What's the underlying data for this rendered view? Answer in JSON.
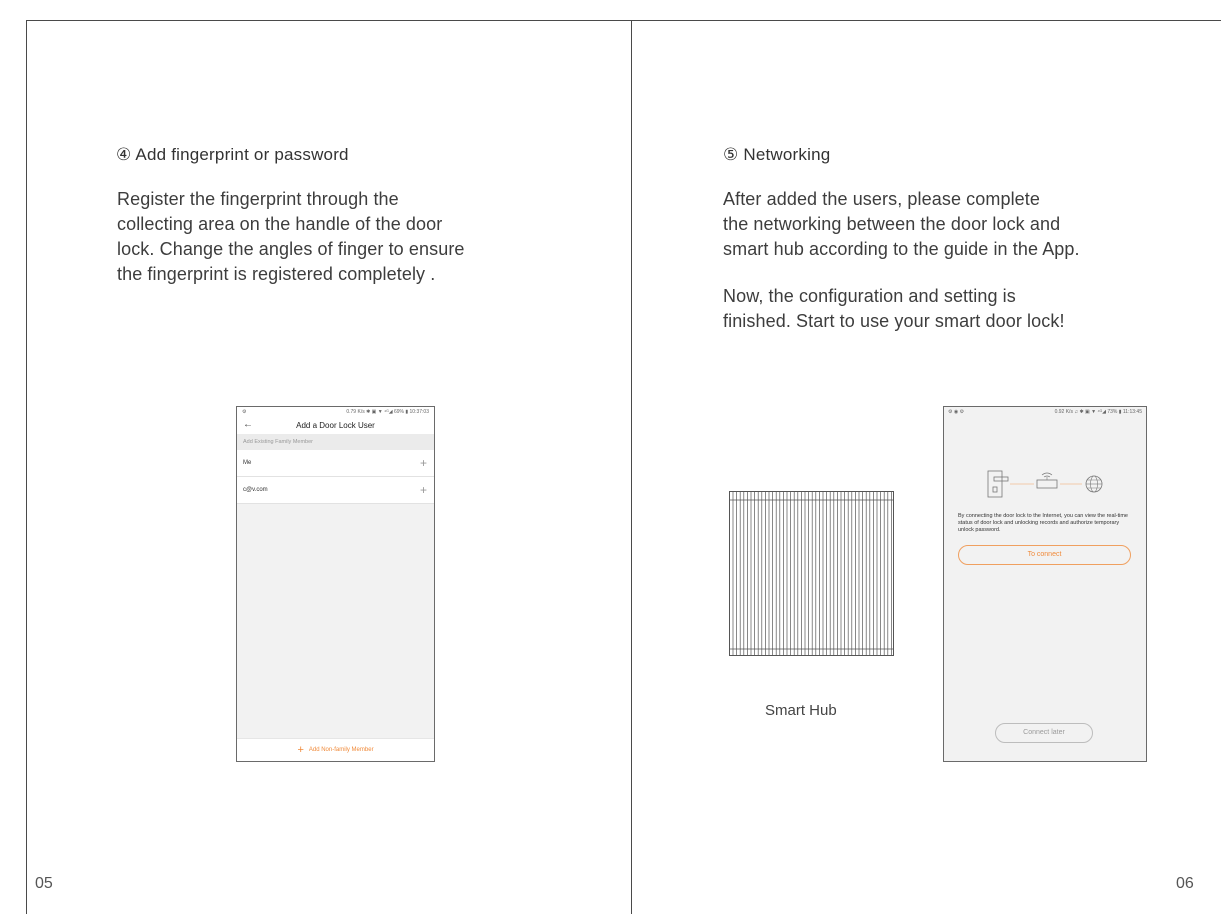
{
  "left_page": {
    "heading": "④ Add fingerprint or password",
    "paragraph_lines": [
      "Register the fingerprint through the",
      "collecting area on the handle of the door",
      "lock. Change the angles of finger to ensure",
      "the fingerprint is registered completely ."
    ],
    "page_number": "05",
    "phone": {
      "status_left": "⚙",
      "status_right": "0.79 K/s  ✱ ▣ ▼ ⁴ᴳ◢ 69% ▮ 10:37:03",
      "back_icon": "←",
      "title": "Add a Door Lock User",
      "section_label": "Add Existing Family Member",
      "rows": [
        {
          "label": "Me",
          "action": "+"
        },
        {
          "label": "c@v.com",
          "action": "+"
        }
      ],
      "bottom_plus": "+",
      "bottom_label": "Add Non-family Member"
    }
  },
  "right_page": {
    "heading": "⑤ Networking",
    "paragraph1_lines": [
      "After added the users, please complete",
      "the networking between the door lock and",
      "smart hub according to the guide in the App."
    ],
    "paragraph2_lines": [
      "Now, the configuration and setting is",
      "finished. Start to use your smart door lock!"
    ],
    "hub_label": "Smart Hub",
    "page_number": "06",
    "phone": {
      "status_left": "⚙ ◉ ⚙",
      "status_right": "0.92 K/s  ♫ ✱ ▣ ▼ ⁴ᴳ◢ 73% ▮ 11:13:45",
      "description": "By connecting the door lock to the Internet, you can view the real-time status of door lock and unlocking records and authorize temporary unlock password.",
      "connect_button": "To connect",
      "later_button": "Connect later"
    }
  },
  "colors": {
    "accent": "#f08a3a",
    "frame": "#4a4a4a",
    "text": "#3d3d3d"
  }
}
